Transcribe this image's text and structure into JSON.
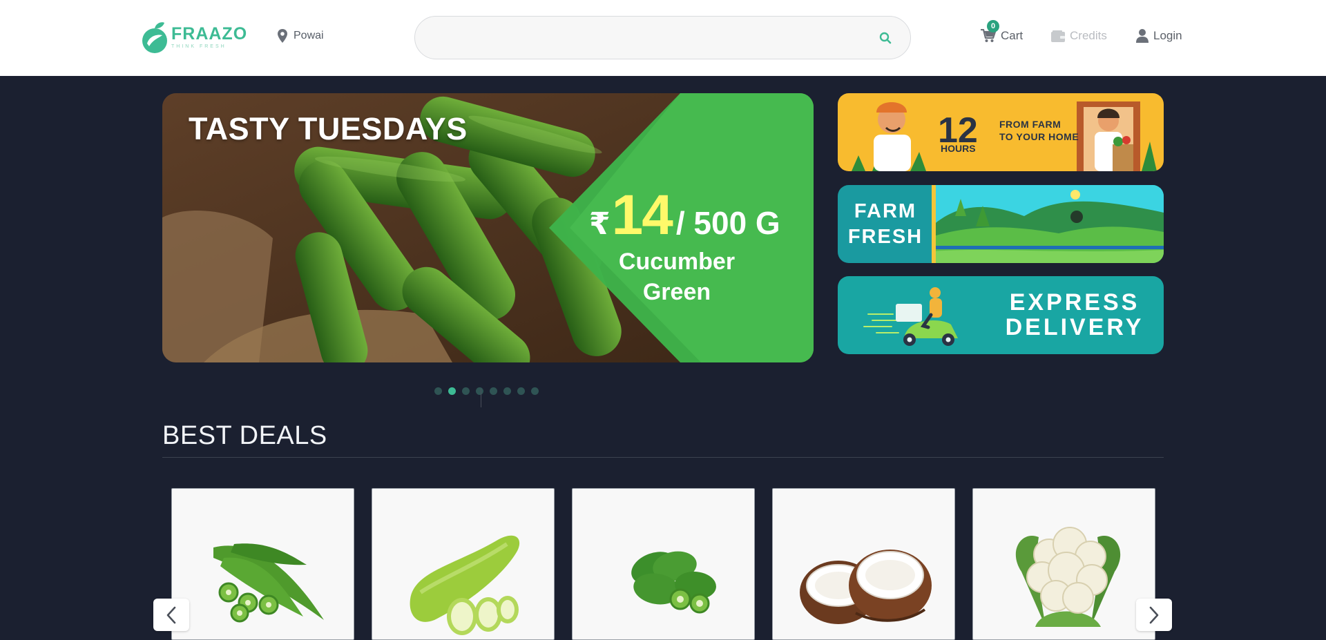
{
  "header": {
    "logo": {
      "name": "FRAAZO",
      "tagline": "THINK FRESH"
    },
    "location": "Powai",
    "search": {
      "value": "",
      "placeholder": ""
    },
    "nav": {
      "cart_label": "Cart",
      "cart_count": "0",
      "credits_label": "Credits",
      "login_label": "Login"
    }
  },
  "hero": {
    "title": "TASTY TUESDAYS",
    "currency": "₹",
    "price": "14",
    "unit": "/ 500 G",
    "product": "Cucumber Green",
    "slides": 8,
    "active_slide": 2
  },
  "side_banners": [
    {
      "hours": "12",
      "hours_word": "HOURS",
      "line1": "FROM FARM",
      "line2": "TO YOUR HOME"
    },
    {
      "text": "FARM FRESH"
    },
    {
      "text": "EXPRESS DELIVERY"
    }
  ],
  "best_deals": {
    "title": "BEST DEALS",
    "products": [
      {
        "icon": "okra-image"
      },
      {
        "icon": "bottle-gourd-image"
      },
      {
        "icon": "pointed-gourd-image"
      },
      {
        "icon": "coconut-image"
      },
      {
        "icon": "cauliflower-image"
      }
    ]
  },
  "colors": {
    "brand": "#3dbb94",
    "page_background": "#1b2030",
    "hero_green": "#3eb34a",
    "banner_yellow": "#f8bb2f",
    "banner_teal": "#19a6a3"
  }
}
